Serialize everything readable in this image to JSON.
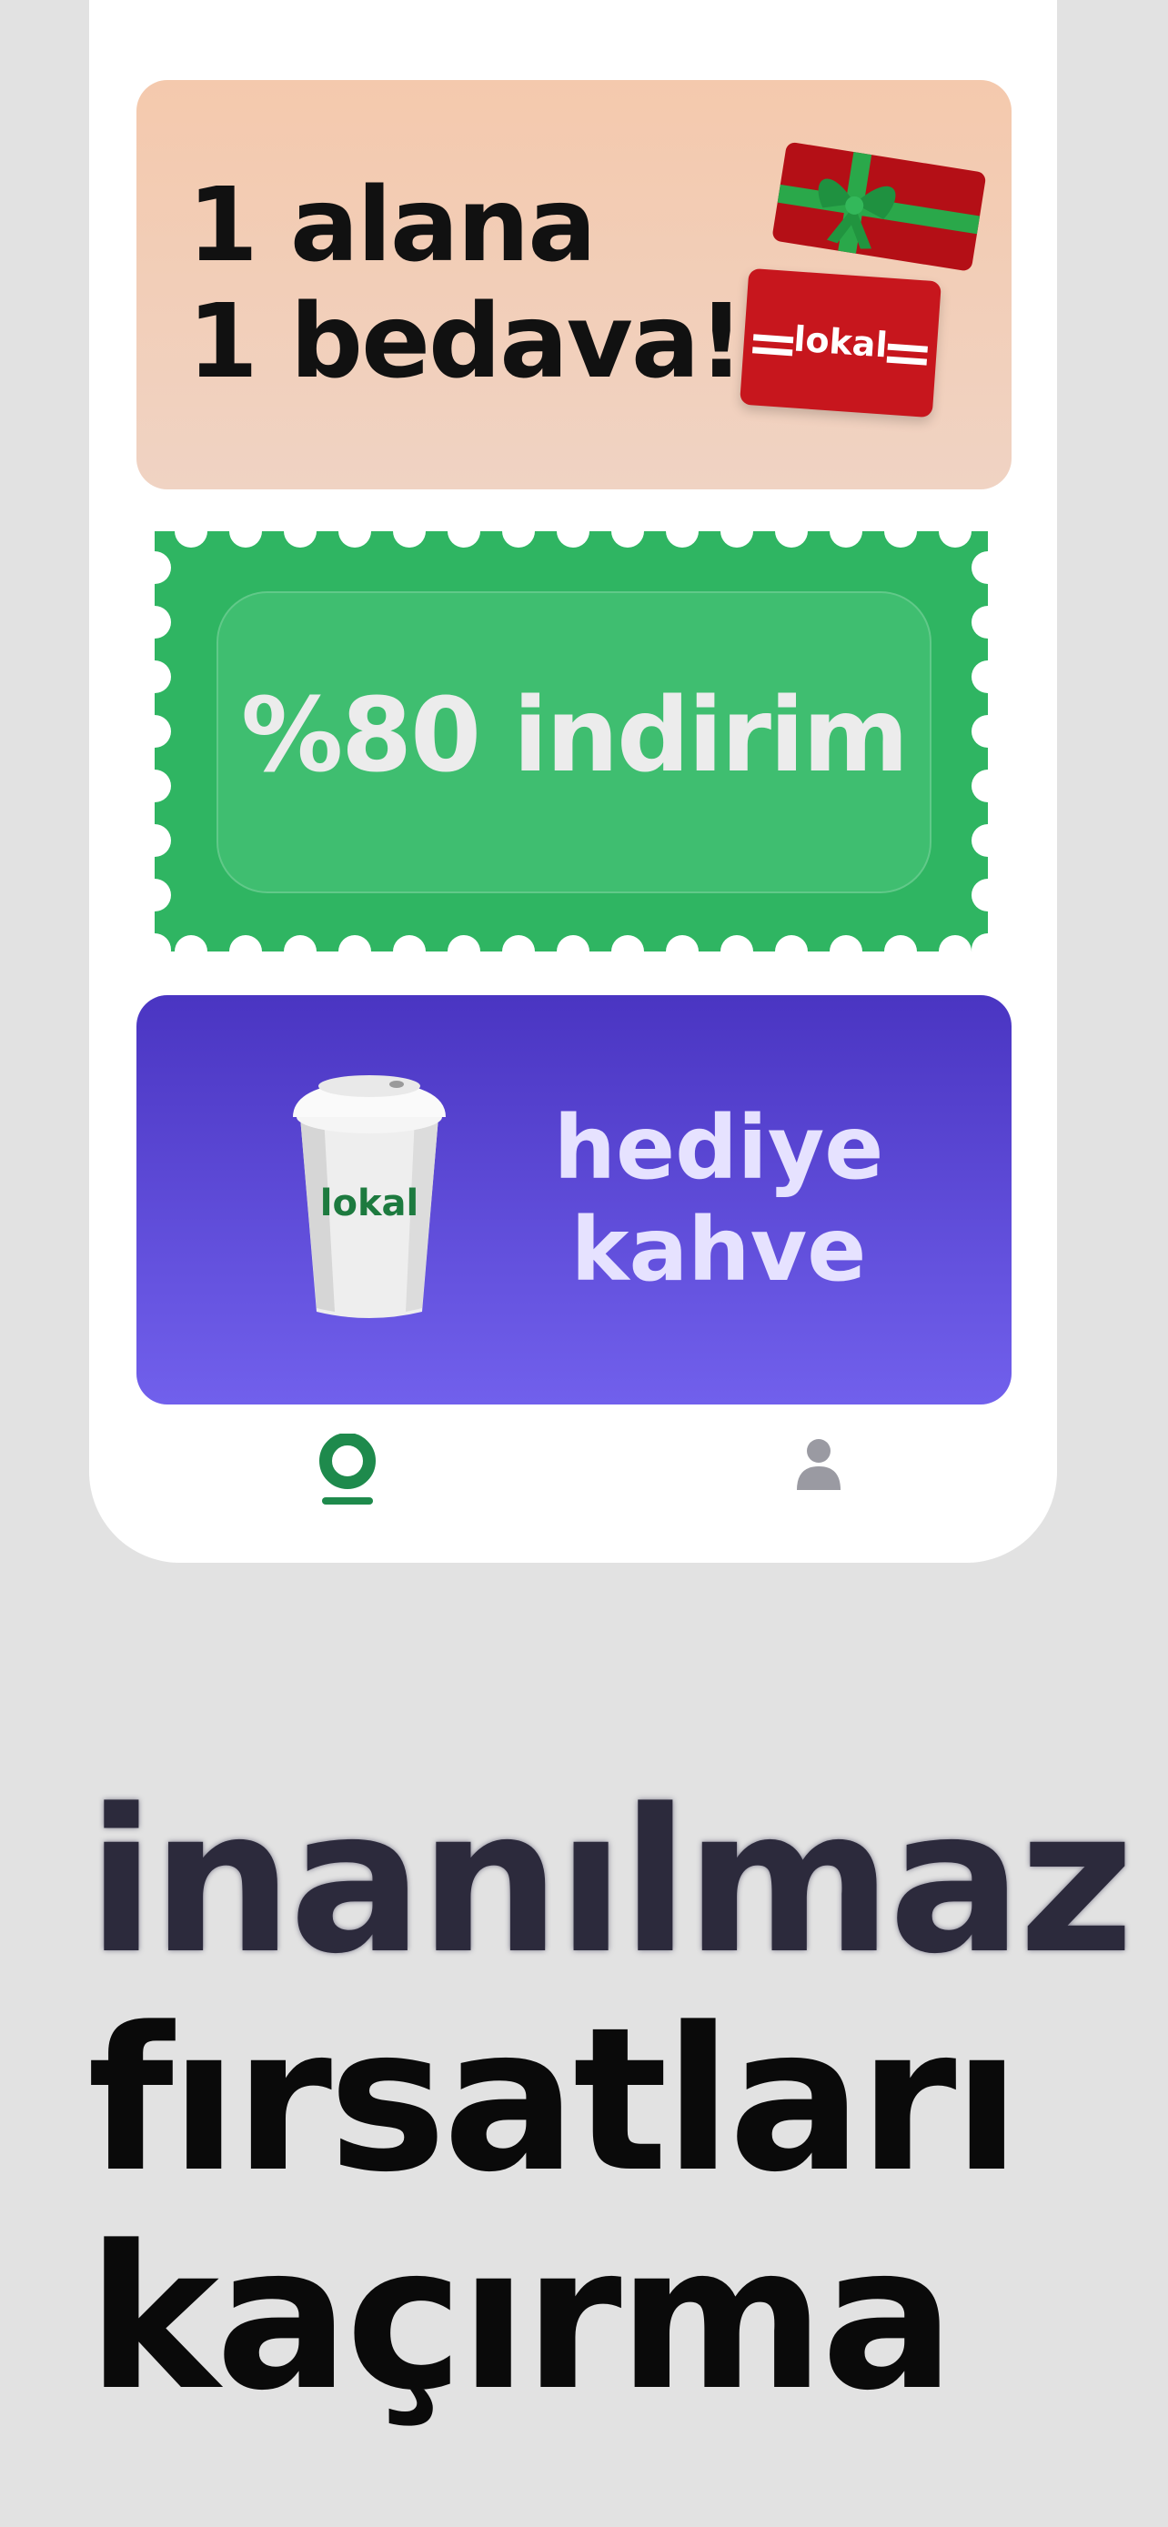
{
  "promo_cards": {
    "bogo": {
      "line1": "1 alana",
      "line2": "1 bedava!",
      "card_brand": "lokal",
      "background": "#f4c9ad"
    },
    "discount": {
      "label": "%80 indirim",
      "background": "#2fb562"
    },
    "gift_coffee": {
      "line1": "hediye",
      "line2": "kahve",
      "cup_brand": "lokal",
      "background": "#5a48d8"
    }
  },
  "bottom_nav": {
    "items": [
      {
        "name": "home",
        "icon": "home-icon",
        "active": true,
        "color": "#1e8a4c"
      },
      {
        "name": "profile",
        "icon": "user-icon",
        "active": false,
        "color": "#9a9aa2"
      }
    ]
  },
  "headline": {
    "line1": "inanılmaz",
    "line2": "fırsatları",
    "line3": "kaçırma"
  }
}
